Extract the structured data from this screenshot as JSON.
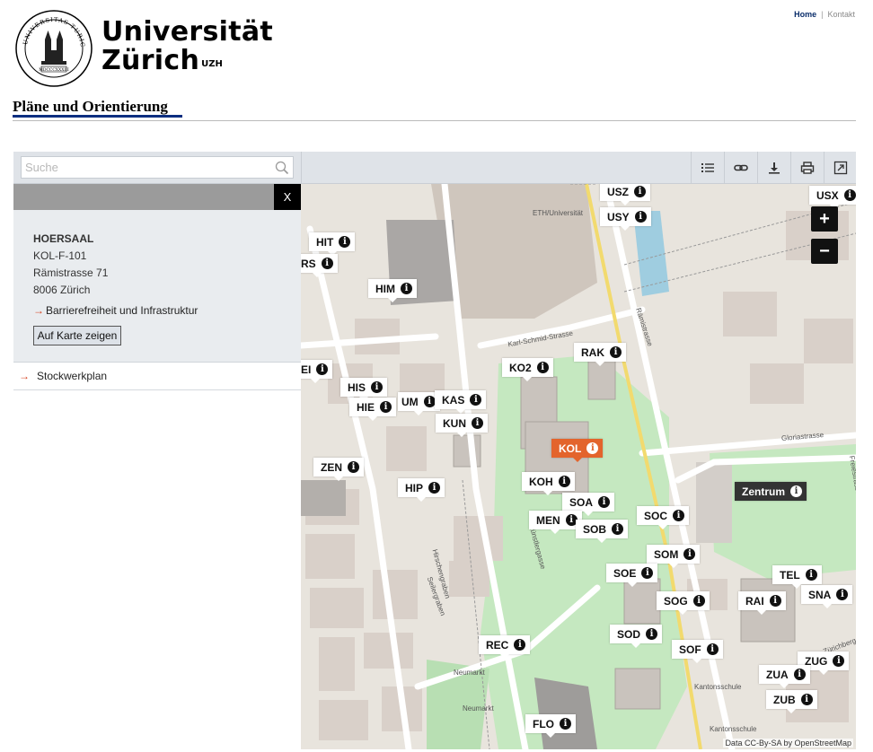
{
  "header": {
    "seal_text_top": "UNIVERSITAS TURICENSIS",
    "seal_year": "MDCCCXXXIII",
    "university_name_line1": "Universität",
    "university_name_line2": "Zürich",
    "university_short": "UZH",
    "links": {
      "home": "Home",
      "separator": "|",
      "contact": "Kontakt"
    },
    "page_title": "Pläne und Orientierung"
  },
  "toolbar": {
    "search_placeholder": "Suche",
    "icons": [
      "list-icon",
      "link-icon",
      "download-icon",
      "print-icon",
      "fullscreen-icon"
    ]
  },
  "sidebar": {
    "close_label": "X",
    "category": "HOERSAAL",
    "room": "KOL-F-101",
    "street": "Rämistrasse 71",
    "city": "8006 Zürich",
    "accessibility_link": "Barrierefreiheit und Infrastruktur",
    "show_on_map": "Auf Karte zeigen",
    "items": [
      {
        "label": "Stockwerkplan"
      }
    ]
  },
  "map": {
    "zoom_in": "+",
    "zoom_out": "−",
    "attribution": "Data CC-By-SA by OpenStreetMap",
    "colors": {
      "selected": "#e3642c",
      "park": "#c5e8c0",
      "building": "#d9d0c9",
      "tram": "#f2da6e"
    },
    "street_labels": [
      "ETH/Universität",
      "Karl-Schmid-Strasse",
      "Rämistrasse",
      "Gloriastrasse",
      "Künstlergasse",
      "Hirschengraben",
      "Seilergraben",
      "Neumarkt",
      "Kantonsschule",
      "Freiestrasse",
      "Zürichbergstrasse"
    ],
    "markers": [
      {
        "label": "USZ"
      },
      {
        "label": "USY"
      },
      {
        "label": "USX"
      },
      {
        "label": "HIT"
      },
      {
        "label": "RS"
      },
      {
        "label": "HIM"
      },
      {
        "label": "RAK"
      },
      {
        "label": "KO2"
      },
      {
        "label": "HIS"
      },
      {
        "label": "HIE"
      },
      {
        "label": "UM"
      },
      {
        "label": "KAS"
      },
      {
        "label": "KUN"
      },
      {
        "label": "KOL"
      },
      {
        "label": "ZEN"
      },
      {
        "label": "KOH"
      },
      {
        "label": "HIP"
      },
      {
        "label": "SOA"
      },
      {
        "label": "Zentrum"
      },
      {
        "label": "MEN"
      },
      {
        "label": "SOC"
      },
      {
        "label": "SOB"
      },
      {
        "label": "SOM"
      },
      {
        "label": "SOE"
      },
      {
        "label": "TEL"
      },
      {
        "label": "SOG"
      },
      {
        "label": "RAI"
      },
      {
        "label": "SNA"
      },
      {
        "label": "SOD"
      },
      {
        "label": "REC"
      },
      {
        "label": "SOF"
      },
      {
        "label": "ZUG"
      },
      {
        "label": "ZUA"
      },
      {
        "label": "ZUB"
      },
      {
        "label": "FLO"
      },
      {
        "label": "EI"
      }
    ]
  }
}
